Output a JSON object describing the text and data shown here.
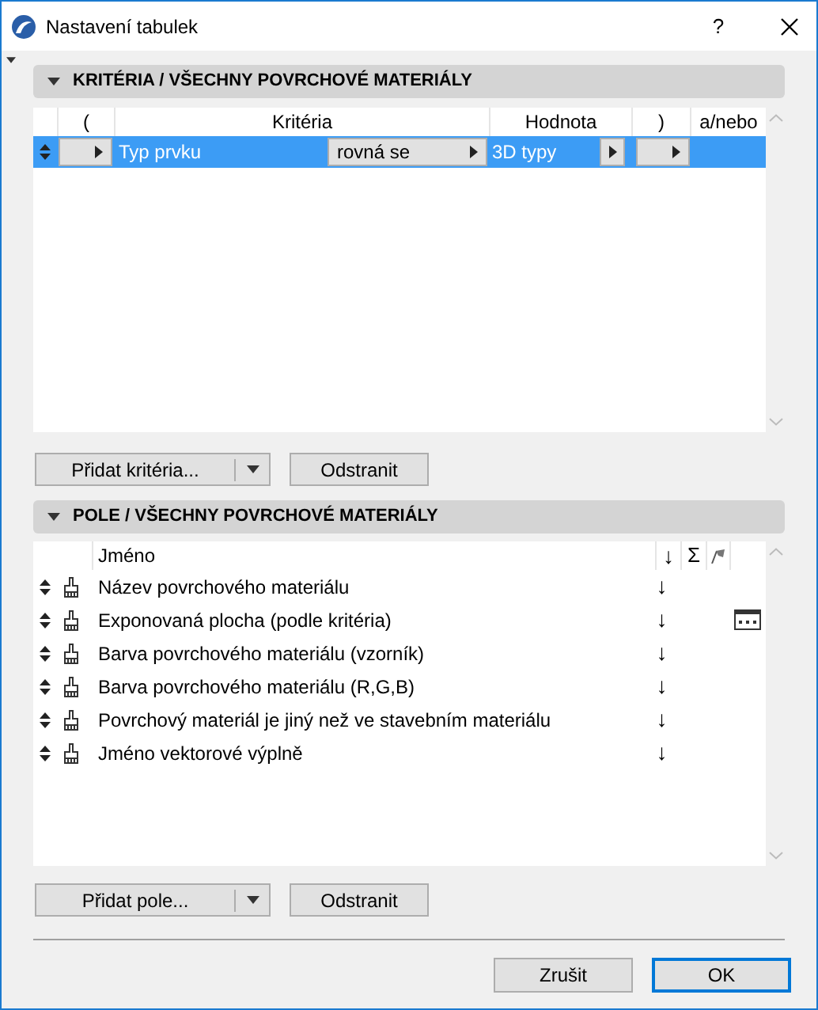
{
  "window": {
    "title": "Nastavení tabulek",
    "help": "?"
  },
  "criteria_section": {
    "title": "KRITÉRIA /  VŠECHNY POVRCHOVÉ MATERIÁLY",
    "expanded": true,
    "columns": [
      "(",
      "Kritéria",
      "Hodnota",
      ")",
      "a/nebo"
    ],
    "rows": [
      {
        "selected": true,
        "element": "Typ prvku",
        "operator": "rovná se",
        "value": "3D typy"
      }
    ],
    "buttons": [
      "Přidat kritéria...",
      "Odstranit"
    ]
  },
  "fields_section": {
    "title": "POLE /  VŠECHNY POVRCHOVÉ MATERIÁLY",
    "expanded": true,
    "columns": {
      "name": "Jméno",
      "sort": "↓",
      "sum": "Σ"
    },
    "rows": [
      {
        "name": "Název povrchového materiálu",
        "sort": "↓",
        "settings": false
      },
      {
        "name": "Exponovaná plocha (podle kritéria)",
        "sort": "↓",
        "settings": true
      },
      {
        "name": "Barva povrchového materiálu (vzorník)",
        "sort": "↓",
        "settings": false
      },
      {
        "name": "Barva povrchového materiálu (R,G,B)",
        "sort": "↓",
        "settings": false
      },
      {
        "name": "Povrchový materiál je jiný než ve stavebním materiálu",
        "sort": "↓",
        "settings": false
      },
      {
        "name": "Jméno vektorové výplně",
        "sort": "↓",
        "settings": false
      }
    ],
    "buttons": [
      "Přidat pole...",
      "Odstranit"
    ]
  },
  "footer_buttons": [
    {
      "label": "Zrušit",
      "default": false
    },
    {
      "label": "OK",
      "default": true
    }
  ]
}
